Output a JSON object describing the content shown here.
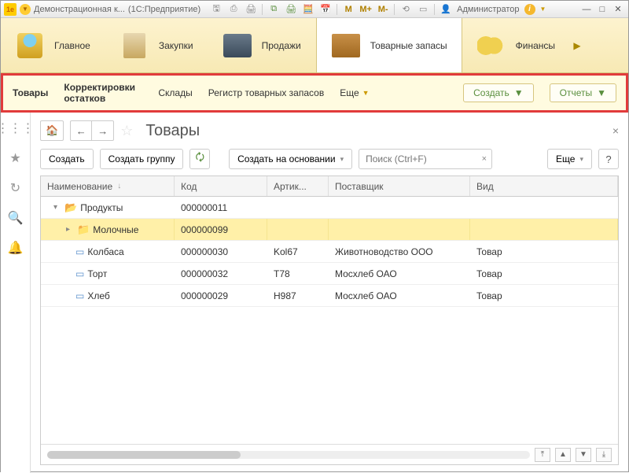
{
  "titlebar": {
    "app_badge": "1e",
    "title": "Демонстрационная к...",
    "mode": "(1С:Предприятие)",
    "m_buttons": [
      "M",
      "M+",
      "M-"
    ],
    "user_label": "Администратор"
  },
  "sections": [
    {
      "label": "Главное",
      "icon": "lamp"
    },
    {
      "label": "Закупки",
      "icon": "bag"
    },
    {
      "label": "Продажи",
      "icon": "register"
    },
    {
      "label": "Товарные запасы",
      "icon": "boxes",
      "active": true
    },
    {
      "label": "Финансы",
      "icon": "coins"
    }
  ],
  "subnav": {
    "links": [
      {
        "text": "Товары",
        "bold": true
      },
      {
        "text": "Корректировки остатков",
        "double": true
      },
      {
        "text": "Склады"
      },
      {
        "text": "Регистр товарных запасов"
      }
    ],
    "more": "Еще",
    "create_btn": "Создать",
    "reports_btn": "Отчеты"
  },
  "page": {
    "title": "Товары"
  },
  "actions": {
    "create": "Создать",
    "create_group": "Создать группу",
    "create_based": "Создать на основании",
    "search_placeholder": "Поиск (Ctrl+F)",
    "more": "Еще",
    "help": "?"
  },
  "table": {
    "columns": {
      "name": "Наименование",
      "code": "Код",
      "article": "Артик...",
      "supplier": "Поставщик",
      "kind": "Вид"
    },
    "rows": [
      {
        "type": "folder-open",
        "indent": 1,
        "name": "Продукты",
        "code": "000000011",
        "article": "",
        "supplier": "",
        "kind": ""
      },
      {
        "type": "folder-sel",
        "indent": 2,
        "name": "Молочные",
        "code": "000000099",
        "article": "",
        "supplier": "",
        "kind": "",
        "highlight": true
      },
      {
        "type": "item",
        "indent": 3,
        "name": "Колбаса",
        "code": "000000030",
        "article": "Kol67",
        "supplier": "Животноводство ООО",
        "kind": "Товар"
      },
      {
        "type": "item",
        "indent": 3,
        "name": "Торт",
        "code": "000000032",
        "article": "T78",
        "supplier": "Мосхлеб ОАО",
        "kind": "Товар"
      },
      {
        "type": "item",
        "indent": 3,
        "name": "Хлеб",
        "code": "000000029",
        "article": "H987",
        "supplier": "Мосхлеб ОАО",
        "kind": "Товар"
      }
    ]
  }
}
